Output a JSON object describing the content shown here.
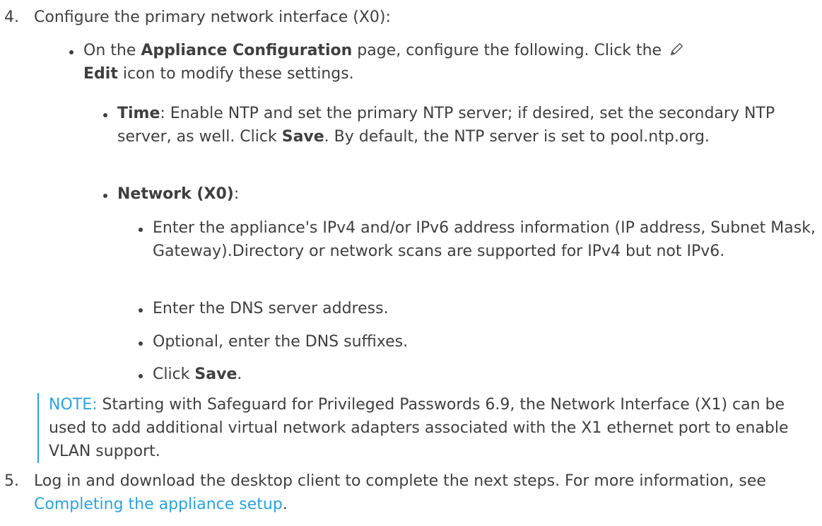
{
  "step4": {
    "number": "4.",
    "title": "Configure the primary network interface (X0):",
    "bullet1": {
      "prefix": "On the ",
      "bold1": "Appliance Configuration",
      "middle": " page, configure the following. Click the ",
      "icon": "pencil-edit-icon",
      "bold2": "Edit",
      "suffix": " icon to modify these settings."
    },
    "time": {
      "label": "Time",
      "text1": ": Enable NTP and set the primary NTP server; if desired, set the secondary NTP server, as well. Click ",
      "save": "Save",
      "text2": ". By default, the NTP server is set to pool.ntp.org."
    },
    "network": {
      "label": "Network (X0)",
      "colon": ":",
      "items": [
        "Enter the appliance's IPv4 and/or IPv6 address information (IP address, Subnet Mask, Gateway).Directory or network scans are supported for IPv4 but not IPv6.",
        "Enter the DNS server address.",
        "Optional, enter the DNS suffixes."
      ],
      "click_prefix": "Click ",
      "click_bold": "Save",
      "click_suffix": "."
    }
  },
  "note": {
    "label": "NOTE:",
    "body": " Starting with Safeguard for Privileged Passwords 6.9, the Network Interface (X1) can be used to add additional virtual network adapters associated with the X1 ethernet port to enable VLAN support."
  },
  "step5": {
    "number": "5.",
    "text": "Log in and download the desktop client to complete the next steps. For more information, see ",
    "link": "Completing the appliance setup",
    "end": "."
  },
  "colors": {
    "text": "#3f3f3f",
    "accent": "#29a3e2"
  }
}
